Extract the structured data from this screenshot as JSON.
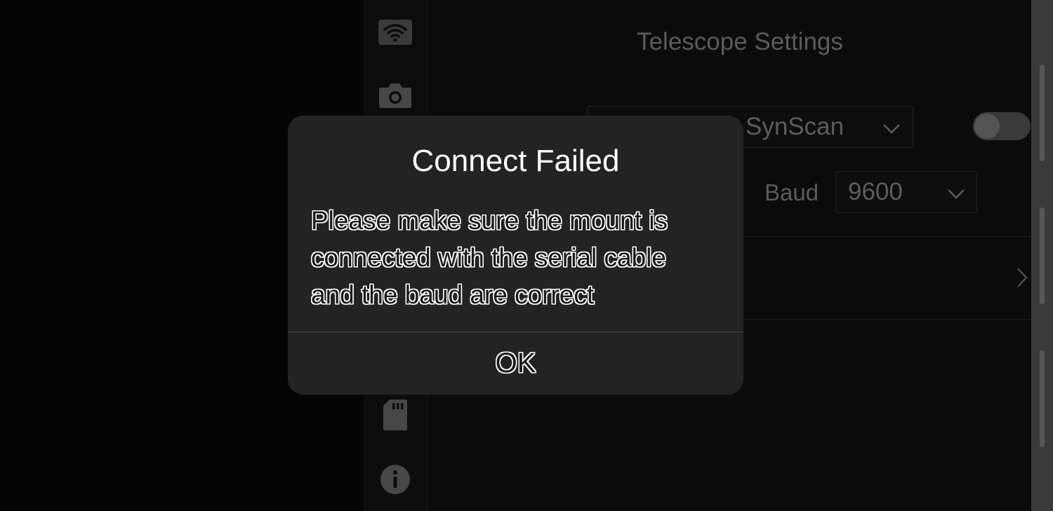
{
  "settings": {
    "title": "Telescope Settings",
    "mount_select": {
      "value": "SynScan"
    },
    "baud": {
      "label": "Baud",
      "value": "9600"
    }
  },
  "rail": {
    "icons": [
      "wifi-icon",
      "camera-icon",
      "sd-card-icon",
      "info-icon"
    ]
  },
  "dialog": {
    "title": "Connect Failed",
    "message_lines": [
      "Please make sure the mount is",
      "connected with the serial cable",
      "and the baud are correct"
    ],
    "ok_label": "OK"
  },
  "colors": {
    "dialog_bg": "#232323",
    "dimmed_text": "#5b5b5b",
    "scrollbar_track": "#3a3a3a"
  }
}
